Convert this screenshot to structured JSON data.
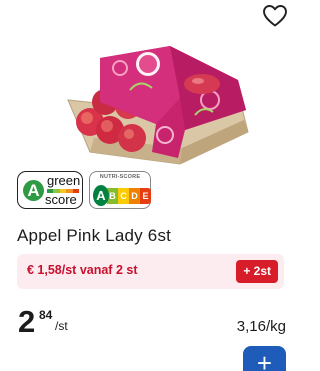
{
  "product": {
    "title": "Appel Pink Lady 6st",
    "image_icon": "apple-tray-image"
  },
  "favorite": {
    "icon": "heart-outline-icon"
  },
  "green_score": {
    "grade": "A",
    "line1": "green",
    "line2": "score",
    "scale_colors": [
      "#2e9a44",
      "#8cc63f",
      "#f4c81e",
      "#f39223",
      "#e63e11"
    ]
  },
  "nutri_score": {
    "label": "NUTRI-SCORE",
    "letters": [
      "A",
      "B",
      "C",
      "D",
      "E"
    ],
    "selected": "A",
    "colors": [
      "#038141",
      "#85bb2f",
      "#fecb02",
      "#ee8100",
      "#e63e11"
    ]
  },
  "promo": {
    "text": "€ 1,58/st vanaf 2 st",
    "button_label": "+ 2st"
  },
  "price": {
    "integer": "2",
    "decimals": "84",
    "unit": "/st"
  },
  "unit_price": "3,16/kg",
  "add_button": {
    "label": "+"
  },
  "colors": {
    "promo_bg": "#fcecef",
    "promo_text": "#c8102e",
    "promo_button": "#d71d2a",
    "add_button": "#1f5bb8"
  }
}
